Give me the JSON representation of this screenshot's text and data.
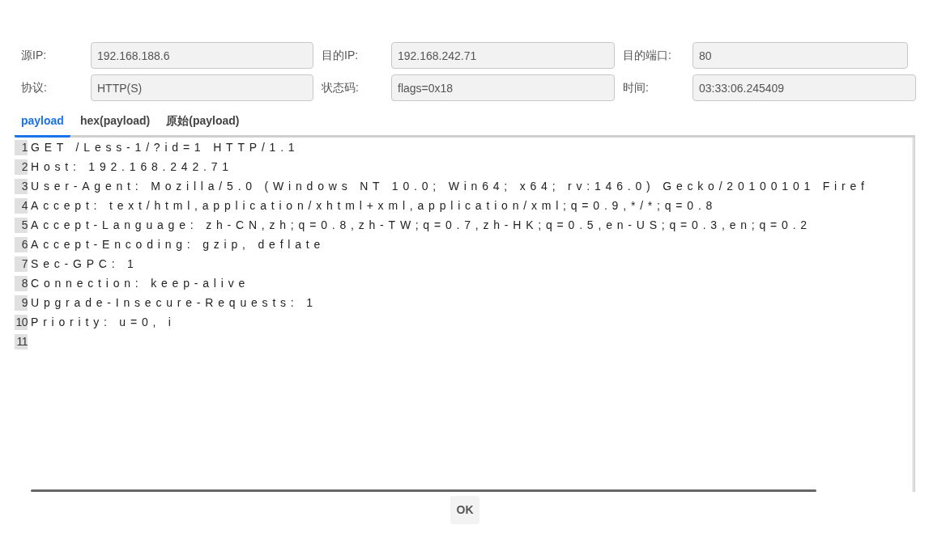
{
  "fields": [
    {
      "label": "源IP:",
      "value": "192.168.188.6"
    },
    {
      "label": "目的IP:",
      "value": "192.168.242.71"
    },
    {
      "label": "目的端口:",
      "value": "80"
    },
    {
      "label": "协议:",
      "value": "HTTP(S)"
    },
    {
      "label": "状态码:",
      "value": "flags=0x18"
    },
    {
      "label": "时间:",
      "value": "03:33:06.245409"
    }
  ],
  "tabs": [
    {
      "label": "payload",
      "selected": true
    },
    {
      "label": "hex(payload)",
      "selected": false
    },
    {
      "label": "原始(payload)",
      "selected": false
    }
  ],
  "editor": {
    "lines": [
      {
        "number": "1",
        "text": "GET /Less-1/?id=1 HTTP/1.1"
      },
      {
        "number": "2",
        "text": "Host: 192.168.242.71"
      },
      {
        "number": "3",
        "text": "User-Agent: Mozilla/5.0 (Windows NT 10.0; Win64; x64; rv:146.0) Gecko/20100101 Firef"
      },
      {
        "number": "4",
        "text": "Accept: text/html,application/xhtml+xml,application/xml;q=0.9,*/*;q=0.8"
      },
      {
        "number": "5",
        "text": "Accept-Language: zh-CN,zh;q=0.8,zh-TW;q=0.7,zh-HK;q=0.5,en-US;q=0.3,en;q=0.2"
      },
      {
        "number": "6",
        "text": "Accept-Encoding: gzip, deflate"
      },
      {
        "number": "7",
        "text": "Sec-GPC: 1"
      },
      {
        "number": "8",
        "text": "Connection: keep-alive"
      },
      {
        "number": "9",
        "text": "Upgrade-Insecure-Requests: 1"
      },
      {
        "number": "10",
        "text": "Priority: u=0, i"
      },
      {
        "number": "11"
      }
    ]
  },
  "buttons": [
    "OK"
  ]
}
